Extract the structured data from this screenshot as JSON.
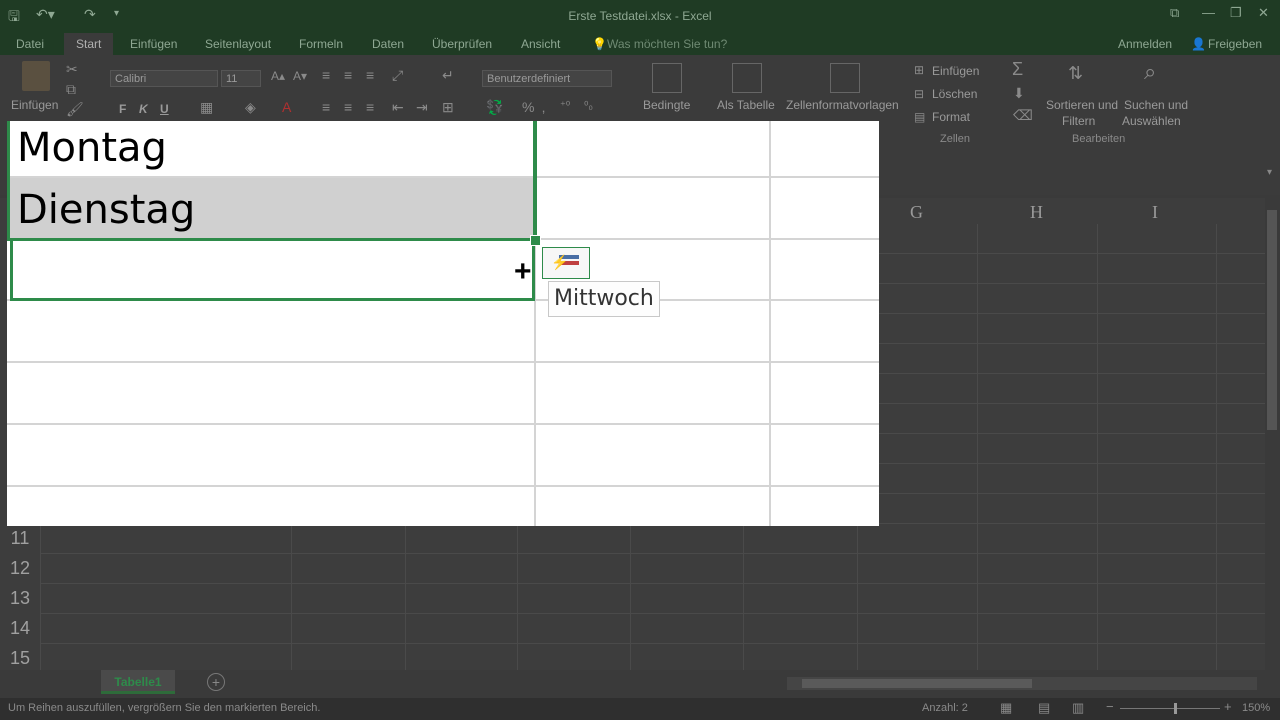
{
  "window": {
    "title": "Erste Testdatei.xlsx - Excel"
  },
  "tabs": [
    {
      "label": "Datei"
    },
    {
      "label": "Start"
    },
    {
      "label": "Einfügen"
    },
    {
      "label": "Seitenlayout"
    },
    {
      "label": "Formeln"
    },
    {
      "label": "Daten"
    },
    {
      "label": "Überprüfen"
    },
    {
      "label": "Ansicht"
    }
  ],
  "tell_me": "Was möchten Sie tun?",
  "account": {
    "signin": "Anmelden",
    "share": "Freigeben"
  },
  "ribbon": {
    "paste": "Einfügen",
    "font_name": "Calibri",
    "font_size": "11",
    "bold": "F",
    "italic": "K",
    "underline": "U",
    "number_format": "Benutzerdefiniert",
    "conditional_formatting": "Bedingte",
    "format_as_table": "Als Tabelle",
    "cell_styles": "Zellenformatvorlagen",
    "insert_cells": "Einfügen",
    "delete_cells": "Löschen",
    "format_cells": "Format",
    "sort_filter_1": "Sortieren und",
    "sort_filter_2": "Filtern",
    "find_select_1": "Suchen und",
    "find_select_2": "Auswählen",
    "group_cells": "Zellen",
    "group_edit": "Bearbeiten"
  },
  "columns": [
    "G",
    "H",
    "I"
  ],
  "rows": [
    "11",
    "12",
    "13",
    "14",
    "15"
  ],
  "zoom": {
    "cell1": "Montag",
    "cell2": "Dienstag",
    "tooltip": "Mittwoch"
  },
  "sheet_tab": "Tabelle1",
  "status": {
    "message": "Um Reihen auszufüllen, vergrößern Sie den markierten Bereich.",
    "count": "Anzahl: 2",
    "zoom_level": "150%"
  },
  "colors": {
    "excel_green": "#217346",
    "selection_green": "#2e8b4a"
  }
}
